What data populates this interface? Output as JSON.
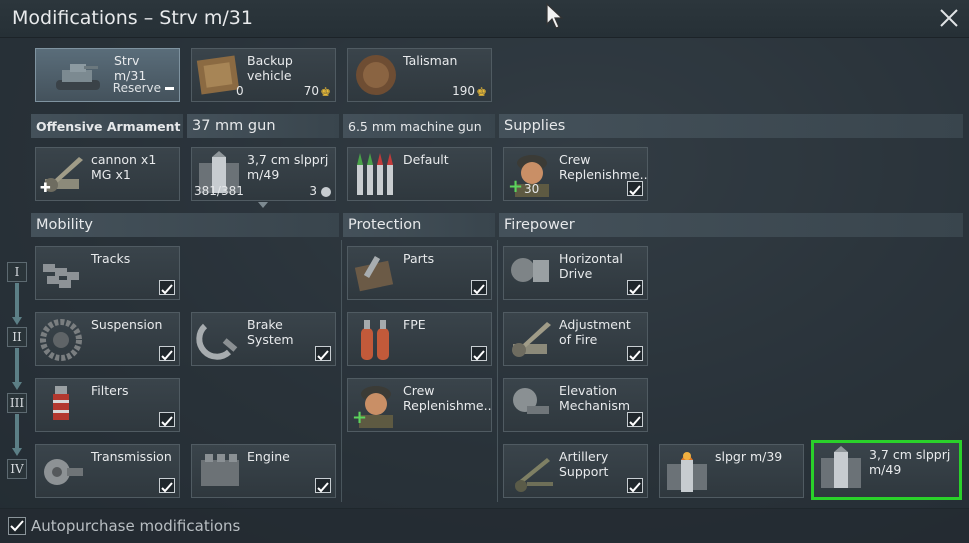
{
  "window": {
    "title": "Modifications – Strv m/31"
  },
  "top_row": {
    "vehicle": {
      "name": "Strv m/31",
      "status": "Reserve"
    },
    "backup": {
      "label": "Backup vehicle",
      "count": "0",
      "price": "70"
    },
    "talisman": {
      "label": "Talisman",
      "price": "190"
    }
  },
  "sections": {
    "offensive_armament": "Offensive Armament",
    "gun": "37 mm gun",
    "mg": "6.5 mm machine gun",
    "supplies": "Supplies",
    "mobility": "Mobility",
    "protection": "Protection",
    "firepower": "Firepower"
  },
  "armament": {
    "cannon": "cannon x1",
    "mg": "MG x1",
    "ammo_name": "3,7 cm slpprj m/49",
    "ammo_count": "381/381",
    "ammo_belts": "3",
    "mg_ammo": "Default",
    "supply_crew": "Crew Replenishme...",
    "supply_count": "30"
  },
  "tiers": [
    "I",
    "II",
    "III",
    "IV"
  ],
  "mobility": [
    "Tracks",
    "Suspension",
    "Brake System",
    "Filters",
    "Transmission",
    "Engine"
  ],
  "protection": [
    "Parts",
    "FPE",
    "Crew Replenishme..."
  ],
  "firepower": [
    "Horizontal Drive",
    "Adjustment of Fire",
    "Elevation Mechanism",
    "Artillery Support",
    "slpgr m/39",
    "3,7 cm slpprj m/49"
  ],
  "footer": {
    "autopurchase": "Autopurchase modifications"
  },
  "colors": {
    "selected": "#2ad12a",
    "gold": "#e8b937"
  }
}
